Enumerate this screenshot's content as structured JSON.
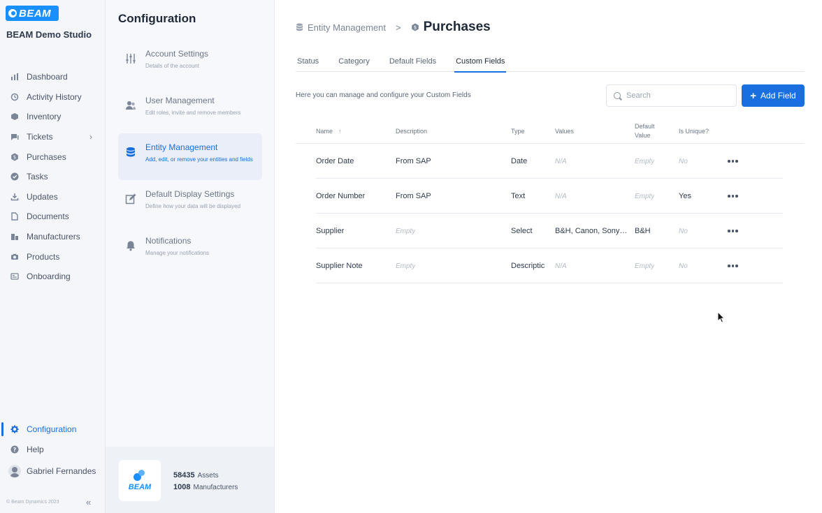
{
  "brand": {
    "logo_text": "BEAM",
    "studio_name": "BEAM Demo Studio"
  },
  "nav": {
    "items": [
      {
        "label": "Dashboard",
        "icon": "bar-chart-icon"
      },
      {
        "label": "Activity History",
        "icon": "history-icon"
      },
      {
        "label": "Inventory",
        "icon": "cube-icon"
      },
      {
        "label": "Tickets",
        "icon": "ticket-icon",
        "has_chevron": true
      },
      {
        "label": "Purchases",
        "icon": "dollar-badge-icon"
      },
      {
        "label": "Tasks",
        "icon": "check-circle-icon"
      },
      {
        "label": "Updates",
        "icon": "download-icon"
      },
      {
        "label": "Documents",
        "icon": "document-icon"
      },
      {
        "label": "Manufacturers",
        "icon": "building-icon"
      },
      {
        "label": "Products",
        "icon": "camera-icon"
      },
      {
        "label": "Onboarding",
        "icon": "id-card-icon"
      }
    ],
    "configuration": "Configuration",
    "help": "Help",
    "user_name": "Gabriel Fernandes",
    "copyright": "© Beam Dynamics 2023"
  },
  "config": {
    "title": "Configuration",
    "menu": [
      {
        "title": "Account Settings",
        "subtitle": "Details of the account",
        "icon": "sliders-icon"
      },
      {
        "title": "User Management",
        "subtitle": "Edit roles, invite and remove members",
        "icon": "users-icon"
      },
      {
        "title": "Entity Management",
        "subtitle": "Add, edit, or remove your entities and fields",
        "icon": "database-icon",
        "active": true
      },
      {
        "title": "Default Display Settings",
        "subtitle": "Define how your data will be displayed",
        "icon": "edit-icon"
      },
      {
        "title": "Notifications",
        "subtitle": "Manage your notifications",
        "icon": "bell-icon"
      }
    ],
    "stats": {
      "assets_count": "58435",
      "assets_label": "Assets",
      "manufacturers_count": "1008",
      "manufacturers_label": "Manufacturers",
      "logo_text": "BEAM"
    }
  },
  "main": {
    "breadcrumb": {
      "parent": "Entity Management",
      "separator": ">",
      "current": "Purchases"
    },
    "tabs": [
      "Status",
      "Category",
      "Default Fields",
      "Custom Fields"
    ],
    "active_tab": "Custom Fields",
    "helper_text": "Here you can manage and configure your Custom Fields",
    "search": {
      "placeholder": "Search",
      "value": ""
    },
    "add_button": "Add Field",
    "table": {
      "headers": {
        "name": "Name",
        "sort_indicator": "↑",
        "description": "Description",
        "type": "Type",
        "values": "Values",
        "default_value_1": "Default",
        "default_value_2": "Value",
        "is_unique": "Is Unique?"
      },
      "rows": [
        {
          "name": "Order Date",
          "description": "From SAP",
          "description_muted": false,
          "type": "Date",
          "values": "N/A",
          "values_muted": true,
          "default": "Empty",
          "default_muted": true,
          "unique": "No",
          "unique_muted": true
        },
        {
          "name": "Order Number",
          "description": "From SAP",
          "description_muted": false,
          "type": "Text",
          "values": "N/A",
          "values_muted": true,
          "default": "Empty",
          "default_muted": true,
          "unique": "Yes",
          "unique_muted": false
        },
        {
          "name": "Supplier",
          "description": "Empty",
          "description_muted": true,
          "type": "Select",
          "values": "B&H, Canon, Sony…",
          "values_muted": false,
          "default": "B&H",
          "default_muted": false,
          "unique": "No",
          "unique_muted": true
        },
        {
          "name": "Supplier Note",
          "description": "Empty",
          "description_muted": true,
          "type": "Descriptic",
          "values": "N/A",
          "values_muted": true,
          "default": "Empty",
          "default_muted": true,
          "unique": "No",
          "unique_muted": true
        }
      ]
    }
  },
  "colors": {
    "accent": "#1a6fe0",
    "brand": "#1a8fff"
  }
}
